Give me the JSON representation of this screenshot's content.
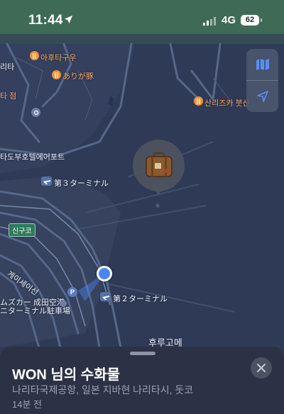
{
  "status": {
    "time": "11:44",
    "network": "4G",
    "battery": "62",
    "icons": [
      "location-arrow-icon",
      "signal-bars-icon",
      "battery-icon"
    ]
  },
  "map": {
    "labels": {
      "ahurukuu": "아후타구우",
      "arigabuta": "ありが豚",
      "ri": "리타",
      "ta_jeom": "타 점",
      "sanrizuka": "산리즈카 붓산",
      "hotel": "타도부호텔에어포트",
      "terminal3": "第３ターミナル",
      "terminal2": "第２ターミナル",
      "sinkuko": "신구코",
      "keisei": "게이세이선",
      "parking_line1": "ムズカー 成田空港",
      "parking_line2": "ニターミナル駐車場",
      "hurukome": "후루고메",
      "parking_symbol": "P"
    },
    "icons": [
      "fork-knife-icon",
      "airport-icon",
      "parking-icon",
      "item-pin-icon",
      "user-location-icon"
    ],
    "colors": {
      "background": "#2f3a56",
      "road": "#4b5a78",
      "user_location": "#4a86f2",
      "poi_orange": "#f0923a"
    }
  },
  "controls": {
    "map_mode_icon": "map-icon",
    "locate_icon": "location-arrow-icon"
  },
  "sheet": {
    "title": "WON 님의 수화물",
    "subtitle": "나리타국제공항, 일본 지바현 나리타시, 돗코",
    "time": "14분 전",
    "close_icon": "close-icon"
  }
}
